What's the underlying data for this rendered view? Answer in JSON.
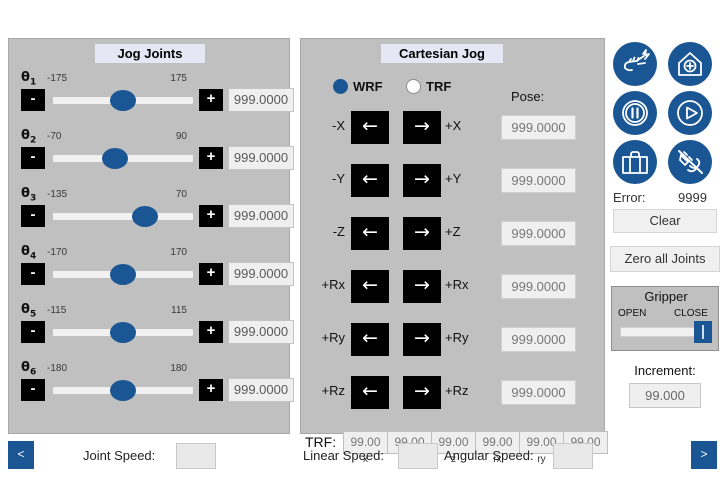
{
  "joint_panel": {
    "title": "Jog Joints",
    "minus_label": "-",
    "plus_label": "+",
    "joints": [
      {
        "name": "θ",
        "index": "1",
        "min": "-175",
        "max": "175",
        "value": "999.0000",
        "thumb_pct": 50
      },
      {
        "name": "θ",
        "index": "2",
        "min": "-70",
        "max": "90",
        "value": "999.0000",
        "thumb_pct": 44
      },
      {
        "name": "θ",
        "index": "3",
        "min": "-135",
        "max": "70",
        "value": "999.0000",
        "thumb_pct": 66
      },
      {
        "name": "θ",
        "index": "4",
        "min": "-170",
        "max": "170",
        "value": "999.0000",
        "thumb_pct": 50
      },
      {
        "name": "θ",
        "index": "5",
        "min": "-115",
        "max": "115",
        "value": "999.0000",
        "thumb_pct": 50
      },
      {
        "name": "θ",
        "index": "6",
        "min": "-180",
        "max": "180",
        "value": "999.0000",
        "thumb_pct": 50
      }
    ]
  },
  "cartesian_panel": {
    "title": "Cartesian Jog",
    "frame_options": [
      {
        "label": "WRF",
        "selected": true
      },
      {
        "label": "TRF",
        "selected": false
      }
    ],
    "pose_label": "Pose:",
    "arrow_left": "←",
    "arrow_right": "→",
    "axes": [
      {
        "neg": "-X",
        "pos": "+X",
        "value": "999.0000"
      },
      {
        "neg": "-Y",
        "pos": "+Y",
        "value": "999.0000"
      },
      {
        "neg": "-Z",
        "pos": "+Z",
        "value": "999.0000"
      },
      {
        "neg": "+Rx",
        "pos": "+Rx",
        "value": "999.0000"
      },
      {
        "neg": "+Ry",
        "pos": "+Ry",
        "value": "999.0000"
      },
      {
        "neg": "+Rz",
        "pos": "+Rz",
        "value": "999.0000"
      }
    ],
    "trf": {
      "label": "TRF:",
      "cells": [
        {
          "value": "99.00",
          "sub": "x"
        },
        {
          "value": "99.00",
          "sub": "y"
        },
        {
          "value": "99.00",
          "sub": "z"
        },
        {
          "value": "99.00",
          "sub": "rx"
        },
        {
          "value": "99.00",
          "sub": "ry"
        },
        {
          "value": "99.00",
          "sub": "rz"
        }
      ]
    }
  },
  "right_panel": {
    "icon_buttons": [
      {
        "icon": "power-connect-icon",
        "row": 0,
        "col": 0
      },
      {
        "icon": "home-icon",
        "row": 0,
        "col": 1
      },
      {
        "icon": "pause-icon",
        "row": 1,
        "col": 0
      },
      {
        "icon": "play-icon",
        "row": 1,
        "col": 1
      },
      {
        "icon": "briefcase-icon",
        "row": 2,
        "col": 0
      },
      {
        "icon": "disconnect-icon",
        "row": 2,
        "col": 1
      }
    ],
    "error_label": "Error:",
    "error_value": "9999",
    "clear_label": "Clear",
    "zero_label": "Zero all Joints",
    "gripper": {
      "title": "Gripper",
      "open_label": "OPEN",
      "close_label": "CLOSE",
      "thumb_pct": 100
    },
    "increment_label": "Increment:",
    "increment_value": "99.000"
  },
  "bottom_bar": {
    "prev_label": "<",
    "next_label": ">",
    "joint_speed_label": "Joint Speed:",
    "joint_speed_value": "",
    "linear_speed_label": "Linear Speed:",
    "linear_speed_value": "",
    "angular_speed_label": "Angular Speed:",
    "angular_speed_value": ""
  },
  "colors": {
    "accent_blue": "#1a5694",
    "panel_gray": "#c0c0c0",
    "title_lavender": "#e6e6f5",
    "button_black": "#000000"
  }
}
